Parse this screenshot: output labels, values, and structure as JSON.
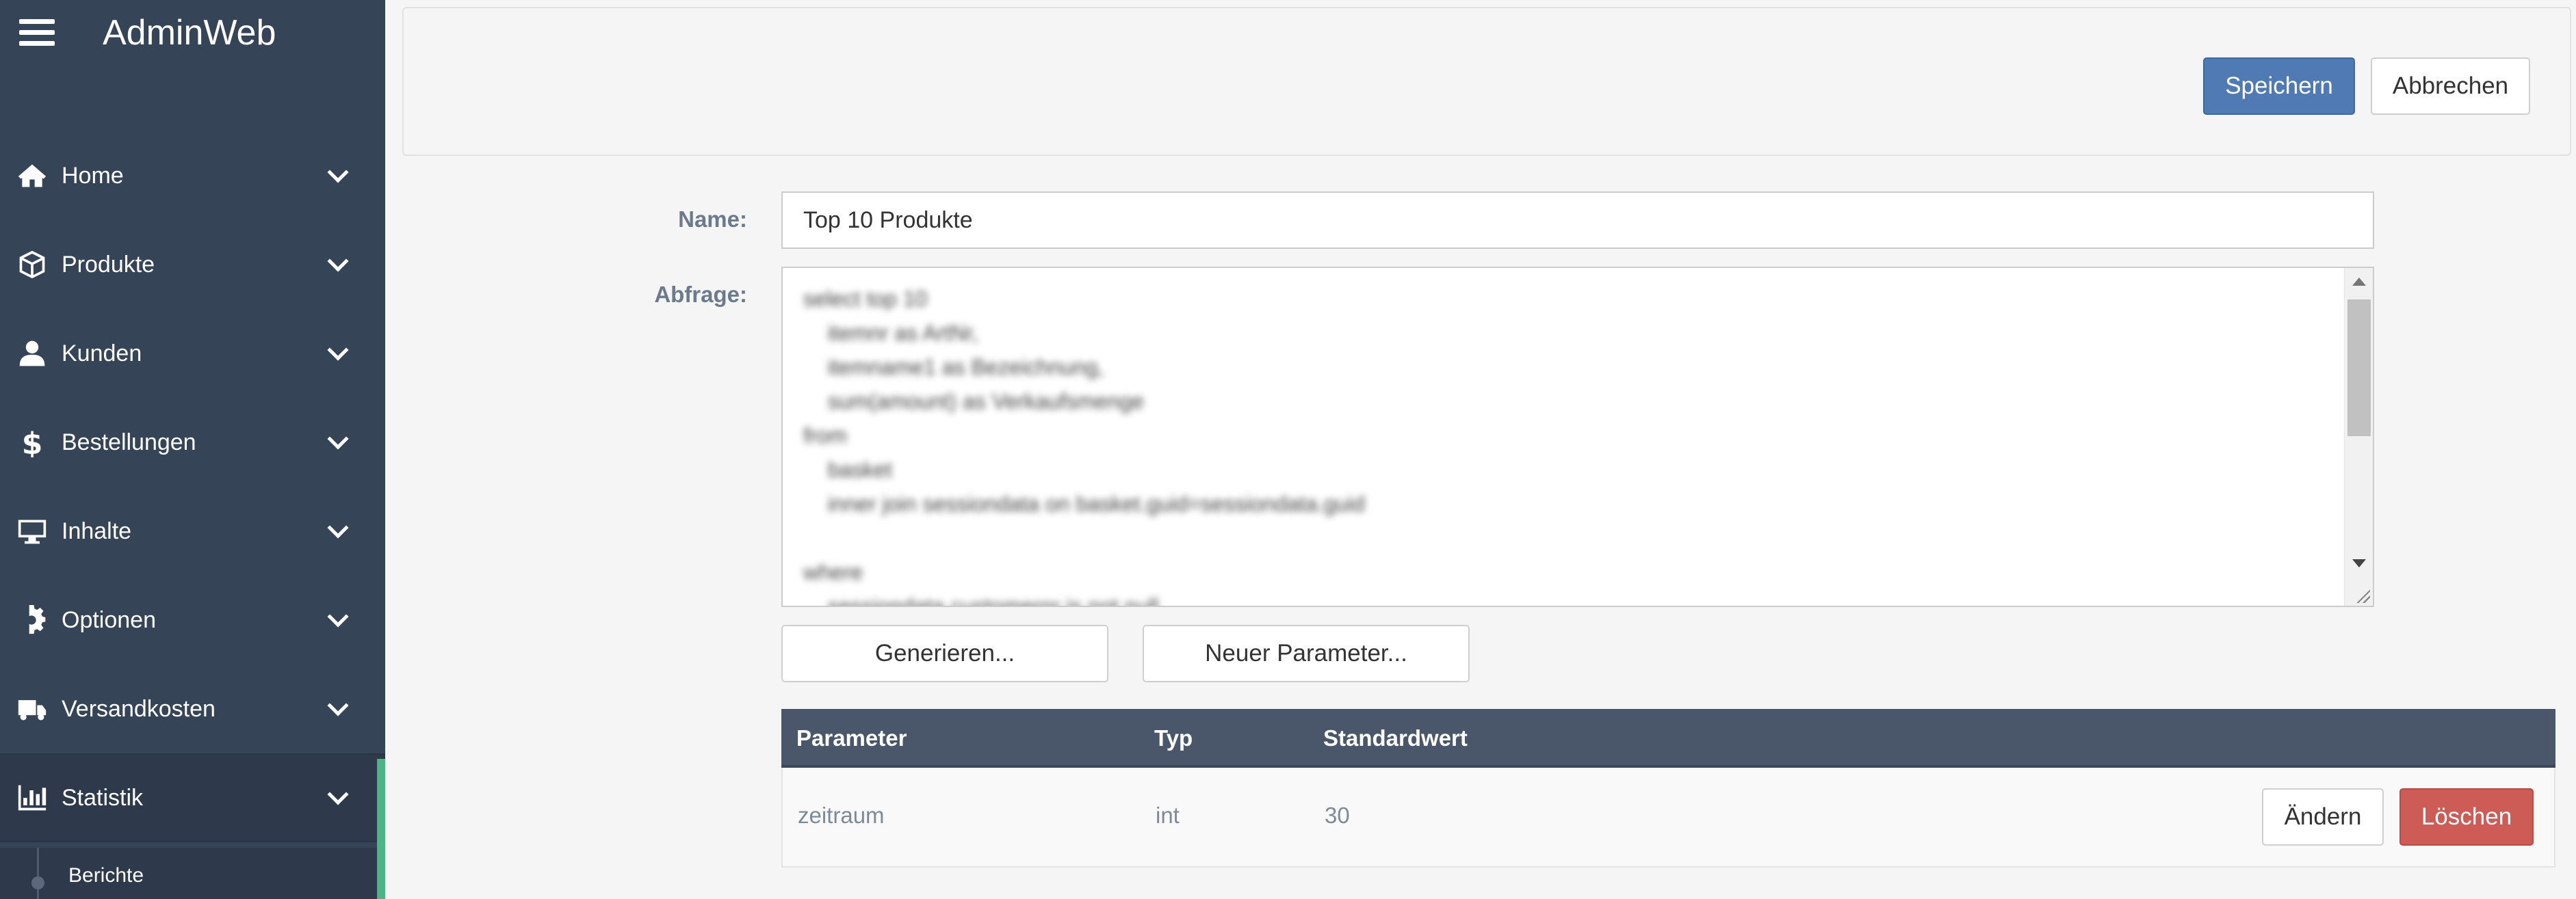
{
  "app": {
    "title": "AdminWeb"
  },
  "sidebar": {
    "items": [
      {
        "label": "Home",
        "icon": "home-icon"
      },
      {
        "label": "Produkte",
        "icon": "box-icon"
      },
      {
        "label": "Kunden",
        "icon": "user-icon"
      },
      {
        "label": "Bestellungen",
        "icon": "dollar-icon"
      },
      {
        "label": "Inhalte",
        "icon": "monitor-icon"
      },
      {
        "label": "Optionen",
        "icon": "gear-icon"
      },
      {
        "label": "Versandkosten",
        "icon": "truck-icon"
      },
      {
        "label": "Statistik",
        "icon": "bar-chart-icon",
        "active": true
      }
    ],
    "subitems": [
      {
        "label": "Berichte"
      }
    ]
  },
  "toolbar": {
    "save_label": "Speichern",
    "cancel_label": "Abbrechen"
  },
  "form": {
    "name_label": "Name:",
    "name_value": "Top 10 Produkte",
    "query_label": "Abfrage:",
    "query_lines": [
      "select top 10",
      "    itemnr as ArtNr,",
      "    itemname1 as Bezeichnung,",
      "    sum(amount) as Verkaufsmenge",
      "from",
      "    basket",
      "    inner join sessiondata on basket.guid=sessiondata.guid",
      "",
      "where",
      "    sessiondata.customernr is not null"
    ],
    "generate_label": "Generieren...",
    "new_param_label": "Neuer Parameter..."
  },
  "table": {
    "headers": [
      "Parameter",
      "Typ",
      "Standardwert"
    ],
    "rows": [
      {
        "parameter": "zeitraum",
        "typ": "int",
        "standardwert": "30",
        "edit_label": "Ändern",
        "delete_label": "Löschen"
      }
    ]
  },
  "colors": {
    "sidebar_bg": "#364458",
    "primary": "#4f7ab3",
    "danger": "#cd5c56",
    "table_header": "#4a5669",
    "active_accent": "#4db585"
  }
}
